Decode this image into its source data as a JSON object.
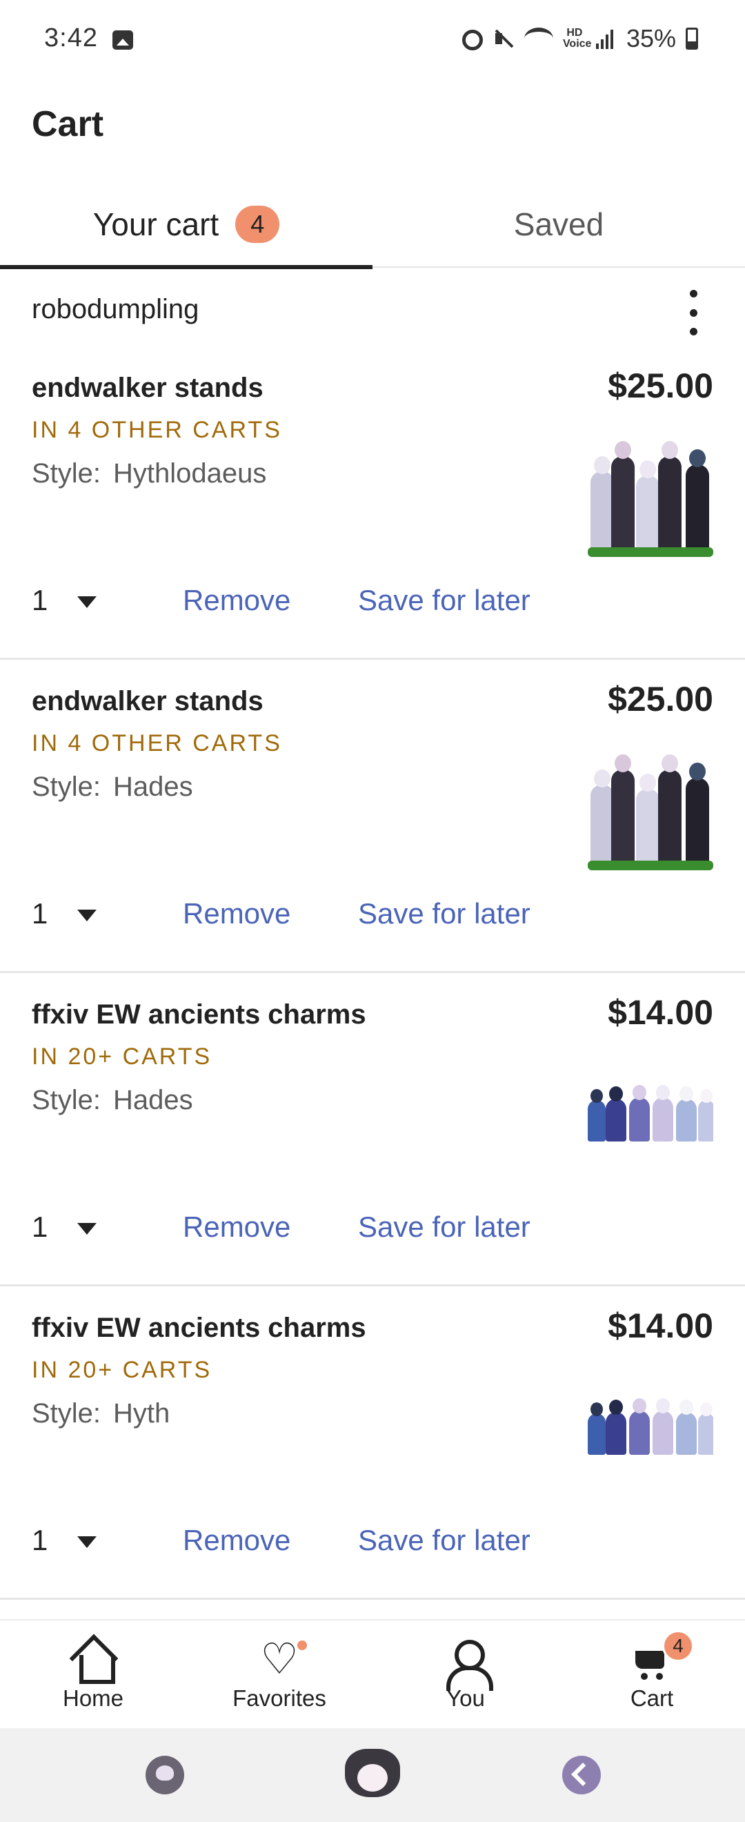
{
  "status_bar": {
    "time": "3:42",
    "hd_label": "HD\nVoice",
    "battery": "35%"
  },
  "header": {
    "title": "Cart"
  },
  "tabs": [
    {
      "label": "Your cart",
      "badge": "4",
      "active": true
    },
    {
      "label": "Saved",
      "active": false
    }
  ],
  "shop": {
    "name": "robodumpling"
  },
  "items": [
    {
      "title": "endwalker stands",
      "carts": "IN 4 OTHER CARTS",
      "style_label": "Style:",
      "style_value": "Hythlodaeus",
      "price": "$25.00",
      "qty": "1",
      "remove": "Remove",
      "save": "Save for later"
    },
    {
      "title": "endwalker stands",
      "carts": "IN 4 OTHER CARTS",
      "style_label": "Style:",
      "style_value": "Hades",
      "price": "$25.00",
      "qty": "1",
      "remove": "Remove",
      "save": "Save for later"
    },
    {
      "title": "ffxiv EW ancients charms",
      "carts": "IN 20+ CARTS",
      "style_label": "Style:",
      "style_value": "Hades",
      "price": "$14.00",
      "qty": "1",
      "remove": "Remove",
      "save": "Save for later"
    },
    {
      "title": "ffxiv EW ancients charms",
      "carts": "IN 20+ CARTS",
      "style_label": "Style:",
      "style_value": "Hyth",
      "price": "$14.00",
      "qty": "1",
      "remove": "Remove",
      "save": "Save for later"
    }
  ],
  "bottom_nav": [
    {
      "label": "Home",
      "icon": "home-icon"
    },
    {
      "label": "Favorites",
      "icon": "heart-icon"
    },
    {
      "label": "You",
      "icon": "person-icon"
    },
    {
      "label": "Cart",
      "icon": "cart-icon",
      "badge": "4"
    }
  ],
  "colors": {
    "accent_orange": "#f1906d",
    "link_blue": "#4b64b8",
    "carts_gold": "#a06a0b"
  }
}
